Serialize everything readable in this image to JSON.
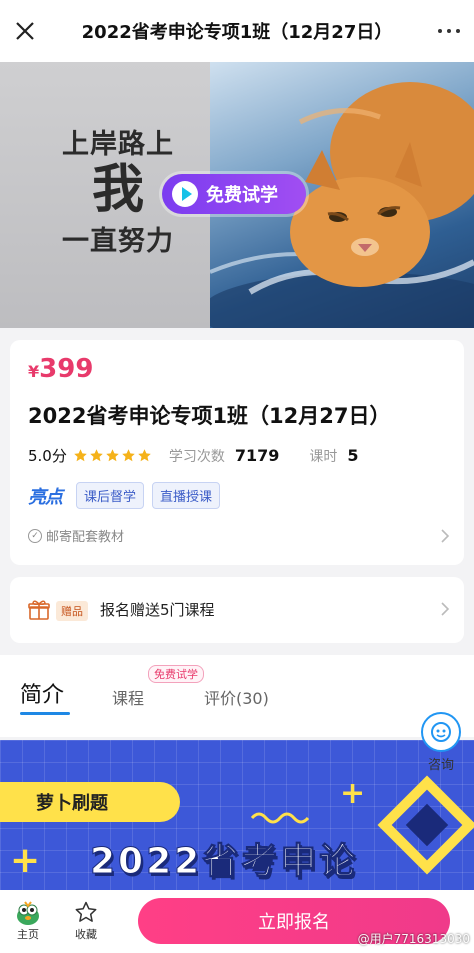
{
  "header": {
    "title": "2022省考申论专项1班（12月27日）",
    "close_icon": "close-icon",
    "more_icon": "more-dots-icon"
  },
  "banner": {
    "slogan_line1": "上岸路上",
    "slogan_line2": "我",
    "slogan_line3": "一直努力",
    "trial_button": "免费试学"
  },
  "course": {
    "currency": "¥",
    "price": "399",
    "title": "2022省考申论专项1班（12月27日）",
    "rating": "5.0分",
    "stars": 5,
    "study_count_label": "学习次数",
    "study_count": "7179",
    "lessons_label": "课时",
    "lessons": "5",
    "highlight_badge": "亮点",
    "tags": [
      "课后督学",
      "直播授课"
    ],
    "mail_text": "邮寄配套教材"
  },
  "gift": {
    "badge": "赠品",
    "text": "报名赠送5门课程"
  },
  "tabs": {
    "intro": "简介",
    "course": "课程",
    "course_badge": "免费试学",
    "review": "评价(30)"
  },
  "consult": {
    "label": "咨询"
  },
  "promo": {
    "pill": "萝卜刷题",
    "title": "2022省考申论"
  },
  "bottom_bar": {
    "home_label": "主页",
    "favorite_label": "收藏",
    "enroll_button": "立即报名"
  },
  "watermark": "@用户7716313030",
  "colors": {
    "price": "#e83a6b",
    "enroll": "#ff3f86",
    "tab_underline": "#1e88e5",
    "promo_bg": "#3d58d8",
    "star": "#f5b21a"
  }
}
